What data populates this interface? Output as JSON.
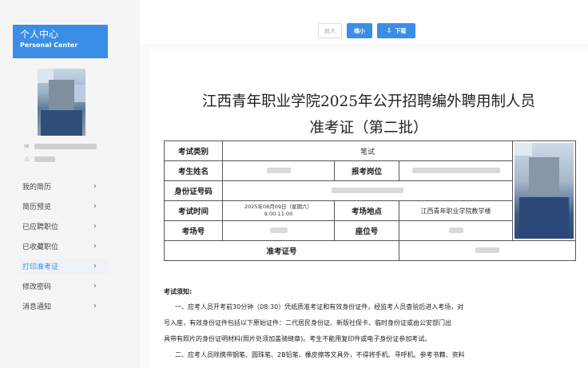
{
  "sidebar": {
    "header_title": "个人中心",
    "header_subtitle": "Personal Center",
    "menu": [
      {
        "label": "我的简历",
        "chevron": "›"
      },
      {
        "label": "简历预览",
        "chevron": "›"
      },
      {
        "label": "已应聘职位",
        "chevron": "›"
      },
      {
        "label": "已收藏职位",
        "chevron": "›"
      },
      {
        "label": "打印准考证",
        "chevron": "›"
      },
      {
        "label": "修改密码",
        "chevron": "›"
      },
      {
        "label": "消息通知",
        "chevron": "›"
      }
    ],
    "active_index": 4
  },
  "toolbar": {
    "enlarge_label": "放大",
    "shrink_label": "缩小",
    "download_label": "下载"
  },
  "document": {
    "title_line1": "江西青年职业学院2025年公开招聘编外聘用制人员",
    "title_line2": "准考证（第二批）",
    "exam_category_label": "考试类别",
    "exam_category_value": "笔试",
    "name_label": "考生姓名",
    "position_label": "报考岗位",
    "id_label": "身份证号码",
    "time_label": "考试时间",
    "time_value_line1": "2025年08月09日（星期六）",
    "time_value_line2": "9:00-11:00",
    "venue_label": "考场地点",
    "venue_value": "江西青年职业学院教学楼",
    "room_label": "考场号",
    "seat_label": "座位号",
    "admit_label": "准考证号",
    "notice_title": "考试须知:",
    "notice_p1": "一、应考人员开考前30分钟（08:30）凭纸质准考证和有效身份证件，经监考人员查验后进入考场，对",
    "notice_p2": "号入座，有效身份证件包括以下原始证件：二代居民身份证、新版社保卡、临时身份证或由公安部门出",
    "notice_p3": "具带有照片的身份证明材料(照片处须加盖骑缝章)。考生不能用复印件或电子身份证参加考试。",
    "notice_p4": "二、应考人员除携带钢笔、圆珠笔、2B铅笔、橡皮擦等文具外，不得将手机、寻呼机、参考书籍、资料"
  }
}
